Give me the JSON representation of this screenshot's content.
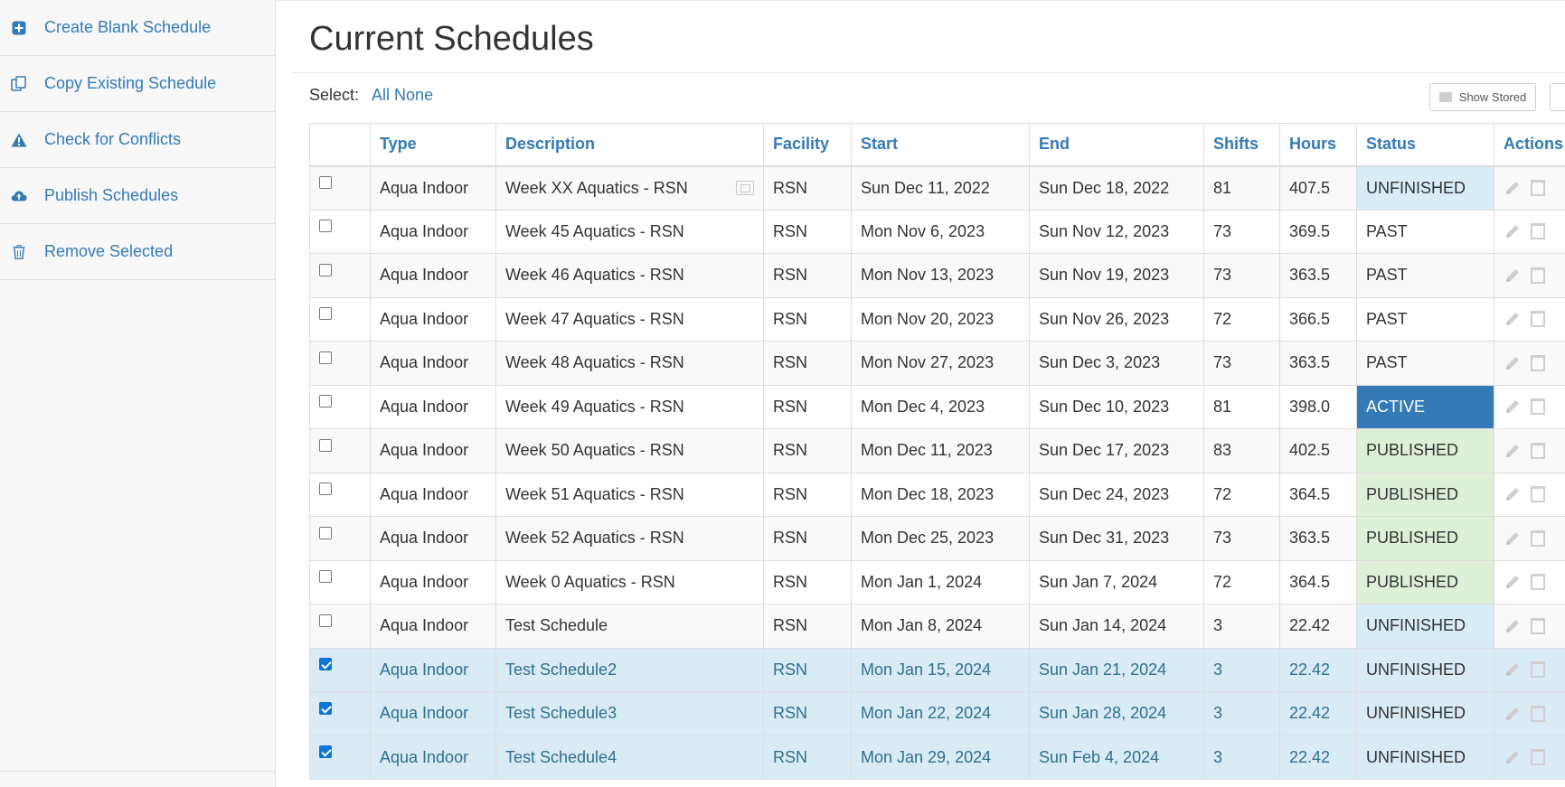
{
  "sidebar": {
    "items": [
      {
        "label": "Create Blank Schedule",
        "icon": "plus-square-icon"
      },
      {
        "label": "Copy Existing Schedule",
        "icon": "copy-icon"
      },
      {
        "label": "Check for Conflicts",
        "icon": "warning-icon"
      },
      {
        "label": "Publish Schedules",
        "icon": "cloud-upload-icon"
      },
      {
        "label": "Remove Selected",
        "icon": "trash-icon"
      }
    ]
  },
  "main": {
    "title": "Current Schedules",
    "select_label": "Select:",
    "select_all": "All",
    "select_none": "None",
    "show_stored": "Show Stored"
  },
  "table": {
    "columns": [
      "",
      "Type",
      "Description",
      "Facility",
      "Start",
      "End",
      "Shifts",
      "Hours",
      "Status",
      "Actions"
    ],
    "rows": [
      {
        "checked": false,
        "type": "Aqua Indoor",
        "description": "Week XX Aquatics - RSN",
        "facility": "RSN",
        "start": "Sun Dec 11, 2022",
        "end": "Sun Dec 18, 2022",
        "shifts": "81",
        "hours": "407.5",
        "status": "UNFINISHED"
      },
      {
        "checked": false,
        "type": "Aqua Indoor",
        "description": "Week 45 Aquatics - RSN",
        "facility": "RSN",
        "start": "Mon Nov 6, 2023",
        "end": "Sun Nov 12, 2023",
        "shifts": "73",
        "hours": "369.5",
        "status": "PAST"
      },
      {
        "checked": false,
        "type": "Aqua Indoor",
        "description": "Week 46 Aquatics - RSN",
        "facility": "RSN",
        "start": "Mon Nov 13, 2023",
        "end": "Sun Nov 19, 2023",
        "shifts": "73",
        "hours": "363.5",
        "status": "PAST"
      },
      {
        "checked": false,
        "type": "Aqua Indoor",
        "description": "Week 47 Aquatics - RSN",
        "facility": "RSN",
        "start": "Mon Nov 20, 2023",
        "end": "Sun Nov 26, 2023",
        "shifts": "72",
        "hours": "366.5",
        "status": "PAST"
      },
      {
        "checked": false,
        "type": "Aqua Indoor",
        "description": "Week 48 Aquatics - RSN",
        "facility": "RSN",
        "start": "Mon Nov 27, 2023",
        "end": "Sun Dec 3, 2023",
        "shifts": "73",
        "hours": "363.5",
        "status": "PAST"
      },
      {
        "checked": false,
        "type": "Aqua Indoor",
        "description": "Week 49 Aquatics - RSN",
        "facility": "RSN",
        "start": "Mon Dec 4, 2023",
        "end": "Sun Dec 10, 2023",
        "shifts": "81",
        "hours": "398.0",
        "status": "ACTIVE"
      },
      {
        "checked": false,
        "type": "Aqua Indoor",
        "description": "Week 50 Aquatics - RSN",
        "facility": "RSN",
        "start": "Mon Dec 11, 2023",
        "end": "Sun Dec 17, 2023",
        "shifts": "83",
        "hours": "402.5",
        "status": "PUBLISHED"
      },
      {
        "checked": false,
        "type": "Aqua Indoor",
        "description": "Week 51 Aquatics - RSN",
        "facility": "RSN",
        "start": "Mon Dec 18, 2023",
        "end": "Sun Dec 24, 2023",
        "shifts": "72",
        "hours": "364.5",
        "status": "PUBLISHED"
      },
      {
        "checked": false,
        "type": "Aqua Indoor",
        "description": "Week 52 Aquatics - RSN",
        "facility": "RSN",
        "start": "Mon Dec 25, 2023",
        "end": "Sun Dec 31, 2023",
        "shifts": "73",
        "hours": "363.5",
        "status": "PUBLISHED"
      },
      {
        "checked": false,
        "type": "Aqua Indoor",
        "description": "Week 0 Aquatics - RSN",
        "facility": "RSN",
        "start": "Mon Jan 1, 2024",
        "end": "Sun Jan 7, 2024",
        "shifts": "72",
        "hours": "364.5",
        "status": "PUBLISHED"
      },
      {
        "checked": false,
        "type": "Aqua Indoor",
        "description": "Test Schedule",
        "facility": "RSN",
        "start": "Mon Jan 8, 2024",
        "end": "Sun Jan 14, 2024",
        "shifts": "3",
        "hours": "22.42",
        "status": "UNFINISHED"
      },
      {
        "checked": true,
        "type": "Aqua Indoor",
        "description": "Test Schedule2",
        "facility": "RSN",
        "start": "Mon Jan 15, 2024",
        "end": "Sun Jan 21, 2024",
        "shifts": "3",
        "hours": "22.42",
        "status": "UNFINISHED"
      },
      {
        "checked": true,
        "type": "Aqua Indoor",
        "description": "Test Schedule3",
        "facility": "RSN",
        "start": "Mon Jan 22, 2024",
        "end": "Sun Jan 28, 2024",
        "shifts": "3",
        "hours": "22.42",
        "status": "UNFINISHED"
      },
      {
        "checked": true,
        "type": "Aqua Indoor",
        "description": "Test Schedule4",
        "facility": "RSN",
        "start": "Mon Jan 29, 2024",
        "end": "Sun Feb 4, 2024",
        "shifts": "3",
        "hours": "22.42",
        "status": "UNFINISHED"
      }
    ]
  },
  "colors": {
    "link": "#337ab7",
    "active": "#337ab7",
    "published": "#dff0d8",
    "unfinished": "#d9edf7",
    "selected_row": "#d9ebf5"
  }
}
